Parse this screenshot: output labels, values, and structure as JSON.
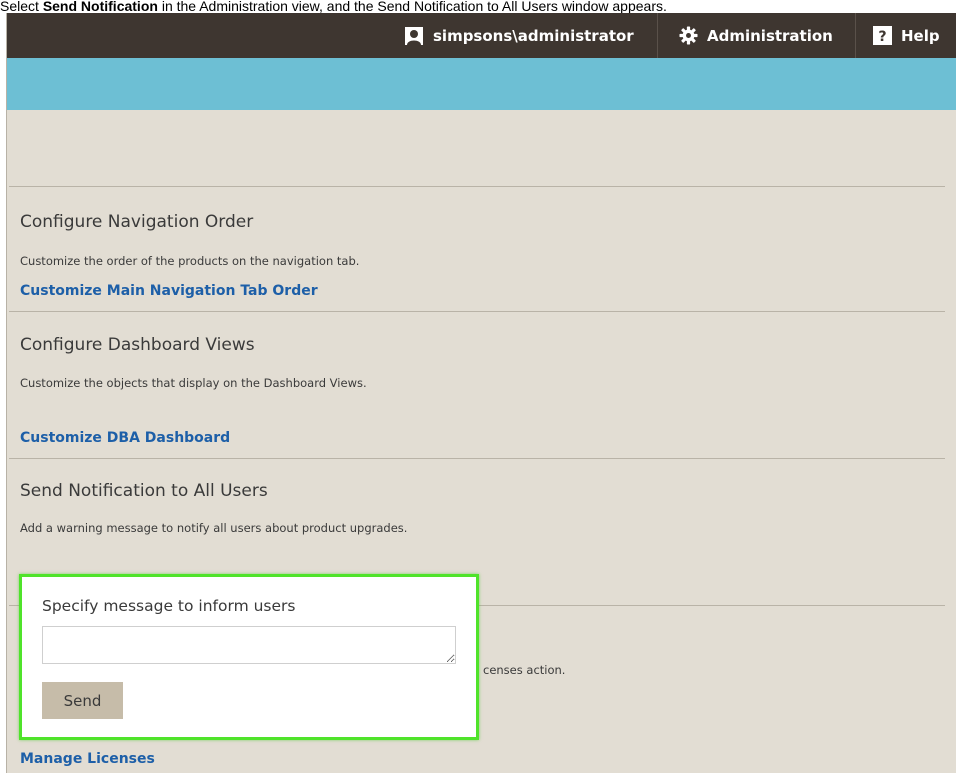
{
  "caption": {
    "prefix": "Select ",
    "bold": "Send Notification",
    "suffix": " in the Administration view, and the Send Notification to All Users window appears."
  },
  "topbar": {
    "user_label": "simpsons\\administrator",
    "admin_label": "Administration",
    "help_label": "Help"
  },
  "sections": {
    "nav_order": {
      "title": "Configure Navigation Order",
      "description": "Customize the order of the products on the navigation tab.",
      "link": "Customize Main Navigation Tab Order"
    },
    "dashboard": {
      "title": "Configure Dashboard Views",
      "description": "Customize the objects that display on the Dashboard Views.",
      "link": "Customize DBA Dashboard"
    },
    "notification": {
      "title": "Send Notification to All Users",
      "description": "Add a warning message to notify all users about product upgrades."
    },
    "licenses": {
      "partial_description": "censes action.",
      "link": "Manage Licenses"
    }
  },
  "popup": {
    "label": "Specify message to inform users",
    "message_value": "",
    "send_label": "Send",
    "border_color": "#4fe32a"
  },
  "colors": {
    "topbar": "#3e3630",
    "accent_bar": "#6dbfd4",
    "background": "#e2ddd3",
    "link": "#1d5fa8"
  }
}
